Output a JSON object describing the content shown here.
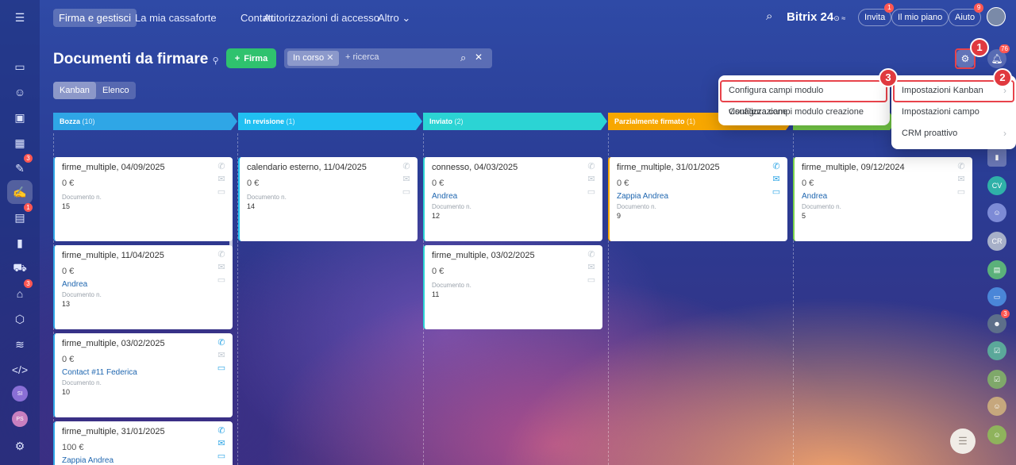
{
  "topnav": {
    "items": [
      "Firma e gestisci",
      "La mia cassaforte",
      "Contatti",
      "Autorizzazioni di accesso",
      "Altro"
    ],
    "logo": "Bitrix",
    "logo_num": "24",
    "invite": "Invita",
    "invite_badge": "1",
    "plan": "Il mio piano",
    "help": "Aiuto",
    "help_badge": "9"
  },
  "header": {
    "title": "Documenti da firmare",
    "create_label": "Firma",
    "filter_chip": "In corso",
    "search_placeholder": "+ ricerca",
    "notif_badge": "76"
  },
  "views": {
    "kanban": "Kanban",
    "list": "Elenco"
  },
  "columns": [
    {
      "name": "Bozza",
      "count": "(10)",
      "color": "#2fa6e6"
    },
    {
      "name": "In revisione",
      "count": "(1)",
      "color": "#20c0f2"
    },
    {
      "name": "Inviato",
      "count": "(2)",
      "color": "#2bd4d4"
    },
    {
      "name": "Parzialmente firmato",
      "count": "(1)",
      "color": "#f7a700"
    }
  ],
  "cards": {
    "c1": {
      "title": "firme_multiple, 04/09/2025",
      "amount": "0 €",
      "contact": "",
      "doc_label": "Documento n.",
      "doc_num": "15"
    },
    "c2": {
      "title": "firme_multiple, 11/04/2025",
      "amount": "0 €",
      "contact": "Andrea",
      "doc_label": "Documento n.",
      "doc_num": "13"
    },
    "c3": {
      "title": "firme_multiple, 03/02/2025",
      "amount": "0 €",
      "contact": "Contact #11 Federica",
      "doc_label": "Documento n.",
      "doc_num": "10"
    },
    "c4": {
      "title": "firme_multiple, 31/01/2025",
      "amount": "100 €",
      "contact": "Zappia Andrea",
      "doc_label": "",
      "doc_num": ""
    },
    "c5": {
      "title": "calendario esterno, 11/04/2025",
      "amount": "0 €",
      "contact": "",
      "doc_label": "Documento n.",
      "doc_num": "14"
    },
    "c6": {
      "title": "connesso, 04/03/2025",
      "amount": "0 €",
      "contact": "Andrea",
      "doc_label": "Documento n.",
      "doc_num": "12"
    },
    "c7": {
      "title": "firme_multiple, 03/02/2025",
      "amount": "0 €",
      "contact": "",
      "doc_label": "Documento n.",
      "doc_num": "11"
    },
    "c8": {
      "title": "firme_multiple, 31/01/2025",
      "amount": "0 €",
      "contact": "Zappia Andrea",
      "doc_label": "Documento n.",
      "doc_num": "9"
    },
    "c9": {
      "title": "firme_multiple, 09/12/2024",
      "amount": "0 €",
      "contact": "Andrea",
      "doc_label": "Documento n.",
      "doc_num": "5"
    }
  },
  "menu_left": [
    "Configura campi modulo visualizzazione",
    "Configura campi modulo creazione"
  ],
  "menu_right": [
    "Impostazioni Kanban",
    "Impostazioni campo",
    "CRM proattivo"
  ],
  "steps": [
    "1",
    "2",
    "3"
  ],
  "left_rail": {
    "badge_tasks": "3",
    "badge_docs": "1",
    "badge_shop": "3",
    "avatar_si": "SI",
    "avatar_ps": "PS"
  },
  "right_rail": {
    "cv": "CV",
    "cr": "CR",
    "bot_badge": "3"
  },
  "icons": [
    "menu-icon",
    "search-icon",
    "gear-icon",
    "bell-icon",
    "phone-icon",
    "mail-icon",
    "chat-icon",
    "pin-icon",
    "plus-icon",
    "close-icon"
  ]
}
